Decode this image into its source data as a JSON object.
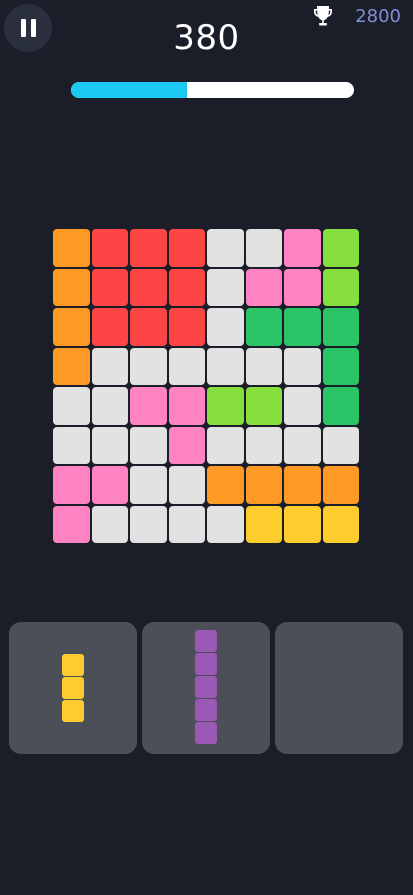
{
  "header": {
    "score": "380",
    "best_score": "2800",
    "progress": 0.41
  },
  "icons": {
    "pause": "pause-icon",
    "trophy": "trophy-icon"
  },
  "palette": {
    "orange": "#fd9a26",
    "red": "#fd4545",
    "gray": "#e2e2e2",
    "pink": "#ff83c3",
    "lime": "#86df3c",
    "green": "#2bc467",
    "yellow": "#fdcd2d",
    "purple": "#9b58b5"
  },
  "board": [
    [
      "orange",
      "red",
      "red",
      "red",
      "gray",
      "gray",
      "pink",
      "lime"
    ],
    [
      "orange",
      "red",
      "red",
      "red",
      "gray",
      "pink",
      "pink",
      "lime"
    ],
    [
      "orange",
      "red",
      "red",
      "red",
      "gray",
      "green",
      "green",
      "green"
    ],
    [
      "orange",
      "gray",
      "gray",
      "gray",
      "gray",
      "gray",
      "gray",
      "green"
    ],
    [
      "gray",
      "gray",
      "pink",
      "pink",
      "lime",
      "lime",
      "gray",
      "green"
    ],
    [
      "gray",
      "gray",
      "gray",
      "pink",
      "gray",
      "gray",
      "gray",
      "gray"
    ],
    [
      "pink",
      "pink",
      "gray",
      "gray",
      "orange",
      "orange",
      "orange",
      "orange"
    ],
    [
      "pink",
      "gray",
      "gray",
      "gray",
      "gray",
      "yellow",
      "yellow",
      "yellow"
    ]
  ],
  "pieces": [
    {
      "color": "yellow",
      "blocks": 3
    },
    {
      "color": "purple",
      "blocks": 5
    },
    null
  ]
}
